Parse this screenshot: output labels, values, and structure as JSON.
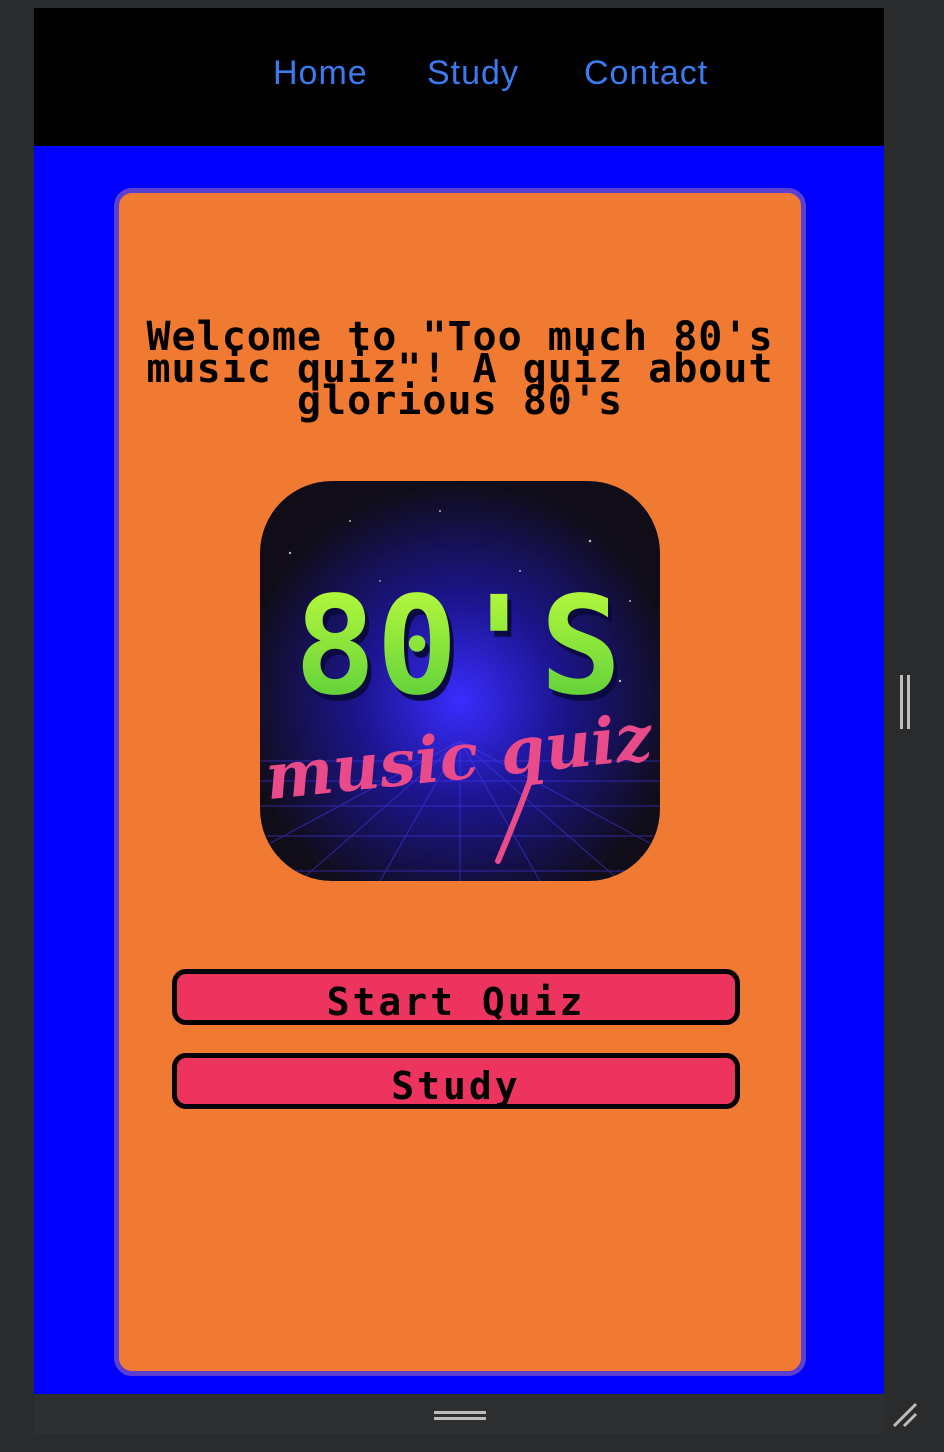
{
  "nav": {
    "home": "Home",
    "study": "Study",
    "contact": "Contact"
  },
  "main": {
    "welcome_text": "Welcome to \"Too much 80's music quiz\"! A quiz about glorious 80's",
    "logo": {
      "big_text": "80'S",
      "script_text": "music quiz"
    },
    "start_button": "Start Quiz",
    "study_button": "Study"
  },
  "colors": {
    "nav_link": "#3a7bf0",
    "page_bg": "#0000ff",
    "card_bg": "#f07a32",
    "card_border": "#5a3fd0",
    "button_bg": "#ec345e"
  }
}
